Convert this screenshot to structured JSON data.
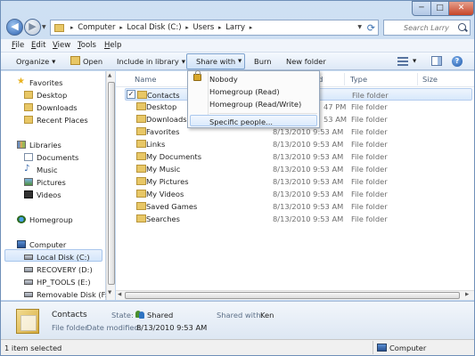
{
  "window": {
    "address_path": [
      "Computer",
      "Local Disk (C:)",
      "Users",
      "Larry"
    ],
    "search_placeholder": "Search Larry",
    "controls": {
      "minimize": "─",
      "maximize": "□",
      "close": "✕"
    }
  },
  "menu": [
    "File",
    "Edit",
    "View",
    "Tools",
    "Help"
  ],
  "toolbar": {
    "organize": "Organize",
    "open": "Open",
    "include_in_library": "Include in library",
    "share_with": "Share with",
    "burn": "Burn",
    "new_folder": "New folder",
    "help": "?"
  },
  "share_menu": {
    "items": [
      "Nobody",
      "Homegroup (Read)",
      "Homegroup (Read/Write)",
      "Specific people..."
    ]
  },
  "nav": {
    "favorites": {
      "label": "Favorites",
      "items": [
        "Desktop",
        "Downloads",
        "Recent Places"
      ]
    },
    "libraries": {
      "label": "Libraries",
      "items": [
        "Documents",
        "Music",
        "Pictures",
        "Videos"
      ]
    },
    "homegroup": "Homegroup",
    "computer": {
      "label": "Computer",
      "items": [
        "Local Disk (C:)",
        "RECOVERY (D:)",
        "HP_TOOLS (E:)",
        "Removable Disk (F:)"
      ]
    }
  },
  "columns": {
    "name": "Name",
    "date": "ed",
    "type": "Type",
    "size": "Size"
  },
  "files": [
    {
      "name": "Contacts",
      "date": "",
      "type": "File folder",
      "selected": true,
      "checked": "✓"
    },
    {
      "name": "Desktop",
      "date": "47 PM",
      "type": "File folder"
    },
    {
      "name": "Downloads",
      "date": "53 AM",
      "type": "File folder"
    },
    {
      "name": "Favorites",
      "date": "8/13/2010 9:53 AM",
      "type": "File folder"
    },
    {
      "name": "Links",
      "date": "8/13/2010 9:53 AM",
      "type": "File folder"
    },
    {
      "name": "My Documents",
      "date": "8/13/2010 9:53 AM",
      "type": "File folder"
    },
    {
      "name": "My Music",
      "date": "8/13/2010 9:53 AM",
      "type": "File folder"
    },
    {
      "name": "My Pictures",
      "date": "8/13/2010 9:53 AM",
      "type": "File folder"
    },
    {
      "name": "My Videos",
      "date": "8/13/2010 9:53 AM",
      "type": "File folder"
    },
    {
      "name": "Saved Games",
      "date": "8/13/2010 9:53 AM",
      "type": "File folder"
    },
    {
      "name": "Searches",
      "date": "8/13/2010 9:53 AM",
      "type": "File folder"
    }
  ],
  "details": {
    "name": "Contacts",
    "type": "File folder",
    "state_label": "State:",
    "state_value": "Shared",
    "shared_with_label": "Shared with:",
    "shared_with_value": "Ken",
    "date_modified_label": "Date modified:",
    "date_modified_value": "8/13/2010 9:53 AM"
  },
  "status": {
    "left": "1 item selected",
    "right": "Computer"
  }
}
